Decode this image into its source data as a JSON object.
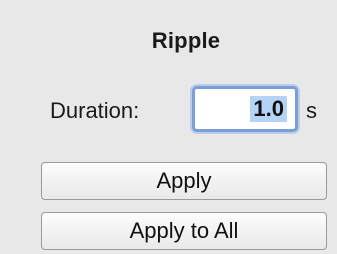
{
  "panel": {
    "title": "Ripple"
  },
  "duration": {
    "label": "Duration:",
    "value": "1.0",
    "unit": "s"
  },
  "buttons": {
    "apply": "Apply",
    "apply_all": "Apply to All"
  }
}
